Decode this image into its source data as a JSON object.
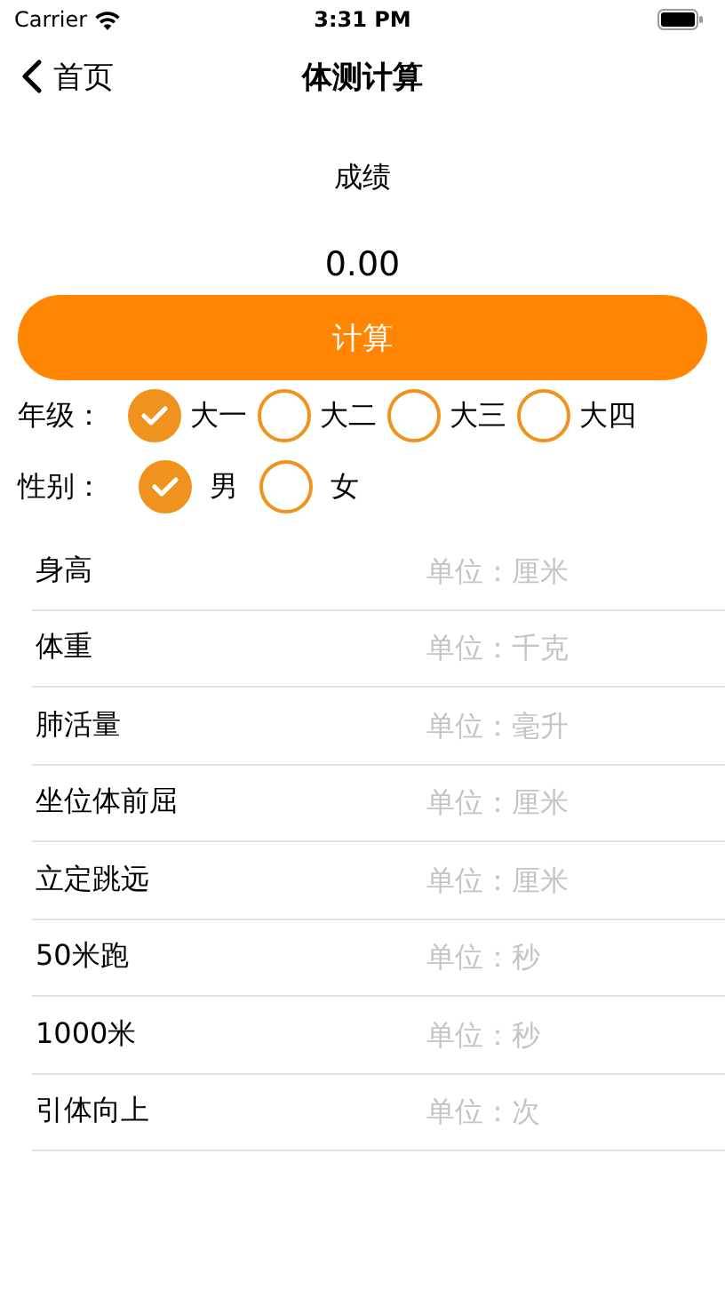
{
  "status_bar": {
    "carrier": "Carrier",
    "time": "3:31 PM"
  },
  "nav": {
    "back": "首页",
    "title": "体测计算"
  },
  "score": {
    "label": "成绩",
    "value": "0.00"
  },
  "calculate_button": "计算",
  "choices": [
    {
      "label": "年级：",
      "options": [
        {
          "label": "大一",
          "selected": true
        },
        {
          "label": "大二",
          "selected": false
        },
        {
          "label": "大三",
          "selected": false
        },
        {
          "label": "大四",
          "selected": false
        }
      ]
    },
    {
      "label": "性别：",
      "options": [
        {
          "label": "男",
          "selected": true
        },
        {
          "label": "女",
          "selected": false
        }
      ]
    }
  ],
  "fields": [
    {
      "label": "身高",
      "placeholder": "单位：厘米"
    },
    {
      "label": "体重",
      "placeholder": "单位：千克"
    },
    {
      "label": "肺活量",
      "placeholder": "单位：毫升"
    },
    {
      "label": "坐位体前屈",
      "placeholder": "单位：厘米"
    },
    {
      "label": "立定跳远",
      "placeholder": "单位：厘米"
    },
    {
      "label": "50米跑",
      "placeholder": "单位：秒"
    },
    {
      "label": "1000米",
      "placeholder": "单位：秒"
    },
    {
      "label": "引体向上",
      "placeholder": "单位：次"
    }
  ]
}
